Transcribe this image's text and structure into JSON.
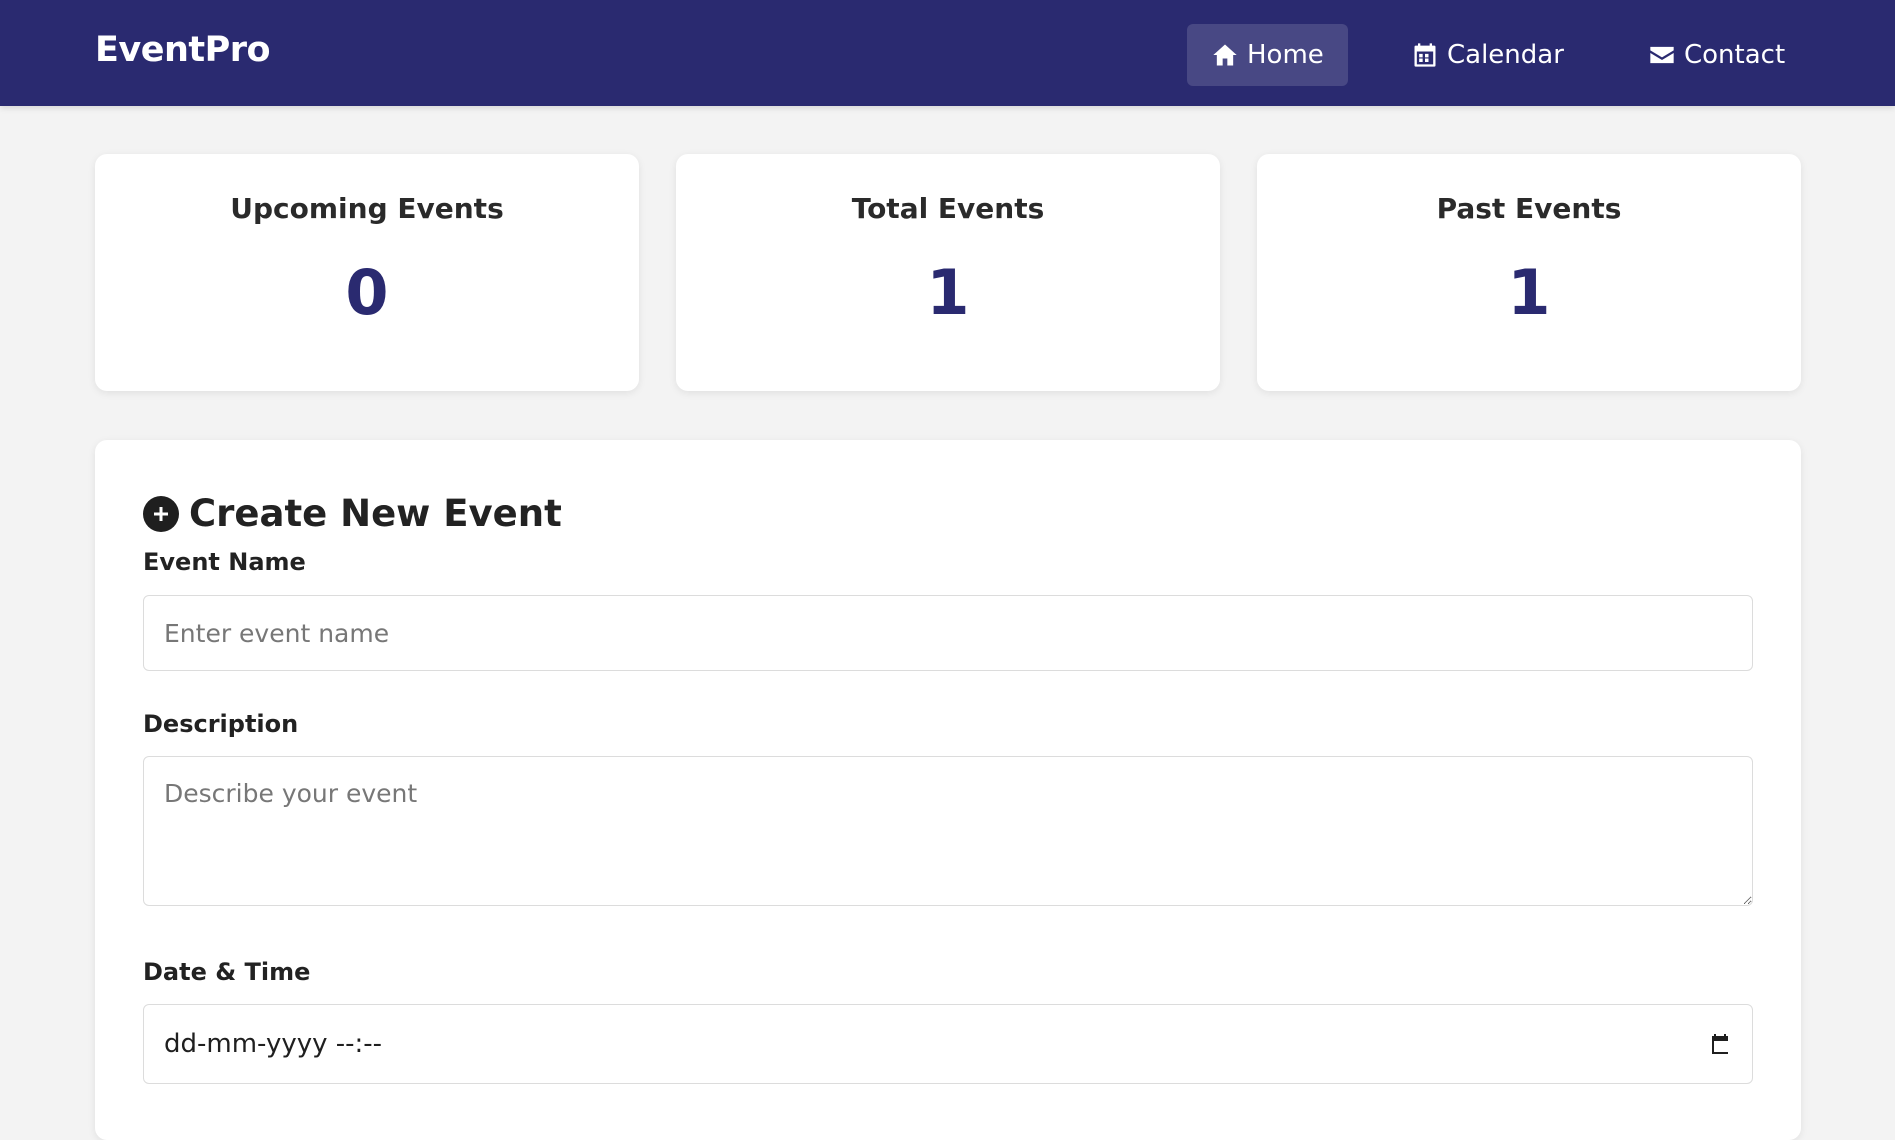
{
  "brand": "EventPro",
  "nav": {
    "home": "Home",
    "calendar": "Calendar",
    "contact": "Contact",
    "active": "home"
  },
  "stats": [
    {
      "title": "Upcoming Events",
      "value": "0"
    },
    {
      "title": "Total Events",
      "value": "1"
    },
    {
      "title": "Past Events",
      "value": "1"
    }
  ],
  "form": {
    "heading": "Create New Event",
    "event_name": {
      "label": "Event Name",
      "placeholder": "Enter event name",
      "value": ""
    },
    "description": {
      "label": "Description",
      "placeholder": "Describe your event",
      "value": ""
    },
    "datetime": {
      "label": "Date & Time",
      "display": "dd-mm-yyyy --:--"
    }
  },
  "colors": {
    "navbar": "#2a2a70",
    "accent": "#2a2a70",
    "background": "#f3f3f3",
    "card": "#ffffff"
  },
  "icons": {
    "home": "home-icon",
    "calendar": "calendar-icon",
    "contact": "envelope-icon",
    "create": "plus-circle-icon",
    "datetime": "calendar-picker-icon"
  }
}
